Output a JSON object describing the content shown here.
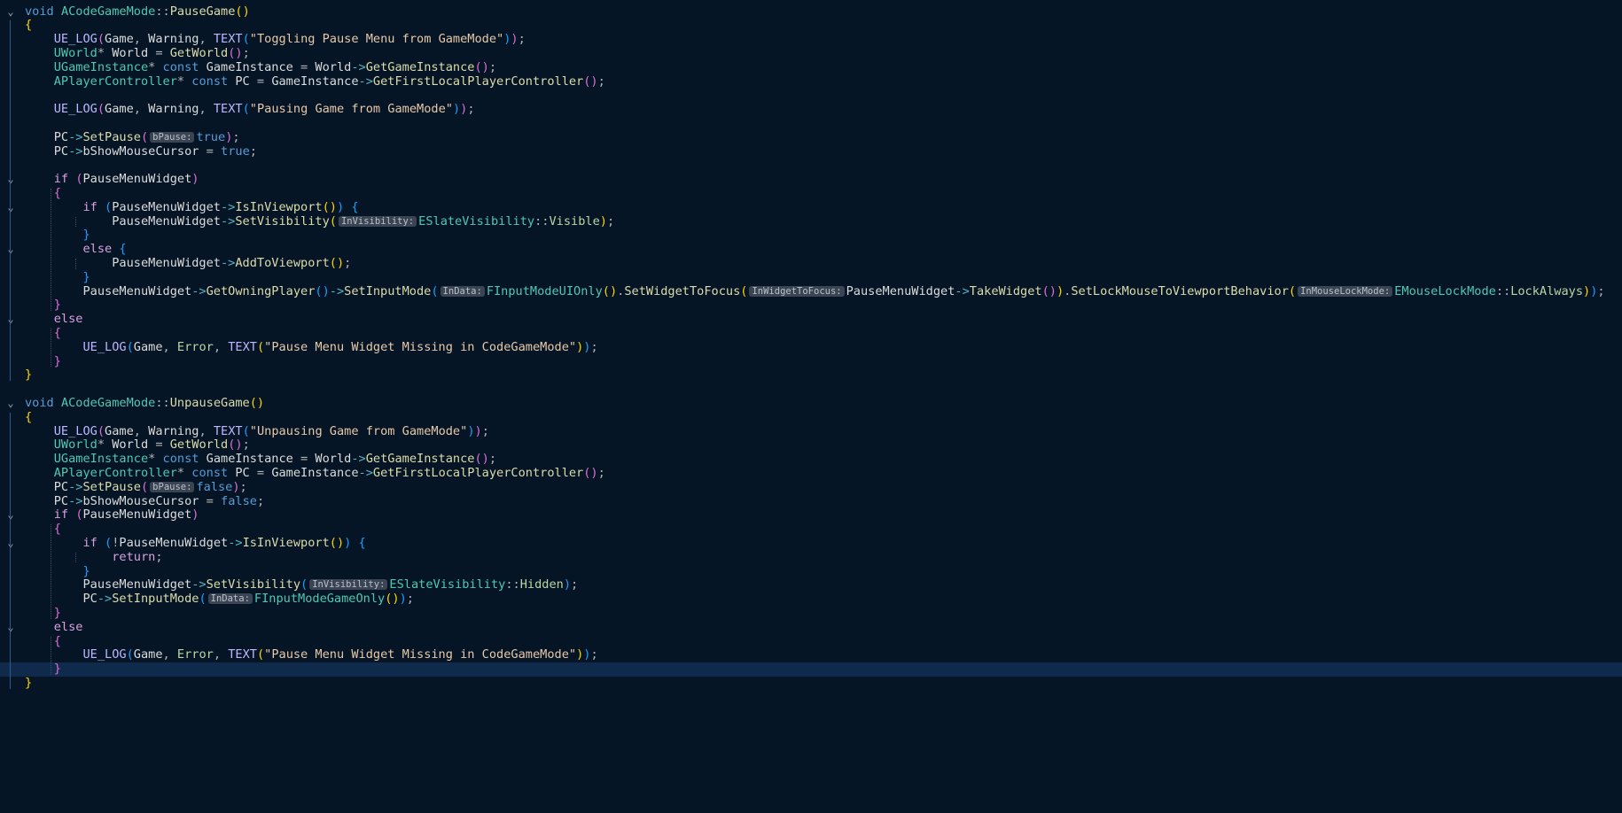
{
  "colors": {
    "background": "#051526",
    "current_line": "#0f2a4a",
    "keyword": "#569cd6",
    "control": "#d8a0df",
    "function": "#dcdcaa",
    "macro": "#beb7ff",
    "string": "#e8c9a7",
    "type": "#4ec9b0",
    "enum": "#b8d7a3"
  },
  "fold_icon": "chevron-down-icon",
  "current_line_index": 47,
  "lines": [
    {
      "fold": true,
      "tokens": [
        [
          "kw",
          "void"
        ],
        [
          "id",
          " "
        ],
        [
          "type",
          "ACodeGameMode"
        ],
        [
          "op",
          "::"
        ],
        [
          "fn",
          "PauseGame"
        ],
        [
          "p1",
          "()"
        ]
      ]
    },
    {
      "tokens": [
        [
          "p1",
          "{"
        ]
      ]
    },
    {
      "tokens": [
        [
          "id",
          "    "
        ],
        [
          "mac",
          "UE_LOG"
        ],
        [
          "p2",
          "("
        ],
        [
          "id",
          "Game"
        ],
        [
          "op",
          ", "
        ],
        [
          "id",
          "Warning"
        ],
        [
          "op",
          ", "
        ],
        [
          "mac",
          "TEXT"
        ],
        [
          "p3",
          "("
        ],
        [
          "str",
          "\"Toggling Pause Menu from GameMode\""
        ],
        [
          "p3",
          ")"
        ],
        [
          "p2",
          ")"
        ],
        [
          "op",
          ";"
        ]
      ]
    },
    {
      "tokens": [
        [
          "id",
          "    "
        ],
        [
          "type",
          "UWorld"
        ],
        [
          "op",
          "* "
        ],
        [
          "var",
          "World"
        ],
        [
          "op",
          " = "
        ],
        [
          "fn",
          "GetWorld"
        ],
        [
          "p2",
          "()"
        ],
        [
          "op",
          ";"
        ]
      ]
    },
    {
      "tokens": [
        [
          "id",
          "    "
        ],
        [
          "type",
          "UGameInstance"
        ],
        [
          "op",
          "* "
        ],
        [
          "kw",
          "const"
        ],
        [
          "id",
          " "
        ],
        [
          "var",
          "GameInstance"
        ],
        [
          "op",
          " = "
        ],
        [
          "var",
          "World"
        ],
        [
          "arrow",
          "->"
        ],
        [
          "fn",
          "GetGameInstance"
        ],
        [
          "p2",
          "()"
        ],
        [
          "op",
          ";"
        ]
      ]
    },
    {
      "tokens": [
        [
          "id",
          "    "
        ],
        [
          "type",
          "APlayerController"
        ],
        [
          "op",
          "* "
        ],
        [
          "kw",
          "const"
        ],
        [
          "id",
          " "
        ],
        [
          "var",
          "PC"
        ],
        [
          "op",
          " = "
        ],
        [
          "var",
          "GameInstance"
        ],
        [
          "arrow",
          "->"
        ],
        [
          "fn",
          "GetFirstLocalPlayerController"
        ],
        [
          "p2",
          "()"
        ],
        [
          "op",
          ";"
        ]
      ]
    },
    {
      "tokens": []
    },
    {
      "tokens": [
        [
          "id",
          "    "
        ],
        [
          "mac",
          "UE_LOG"
        ],
        [
          "p2",
          "("
        ],
        [
          "id",
          "Game"
        ],
        [
          "op",
          ", "
        ],
        [
          "id",
          "Warning"
        ],
        [
          "op",
          ", "
        ],
        [
          "mac",
          "TEXT"
        ],
        [
          "p3",
          "("
        ],
        [
          "str",
          "\"Pausing Game from GameMode\""
        ],
        [
          "p3",
          ")"
        ],
        [
          "p2",
          ")"
        ],
        [
          "op",
          ";"
        ]
      ]
    },
    {
      "tokens": []
    },
    {
      "tokens": [
        [
          "id",
          "    "
        ],
        [
          "var",
          "PC"
        ],
        [
          "arrow",
          "->"
        ],
        [
          "fn",
          "SetPause"
        ],
        [
          "p2",
          "("
        ],
        [
          "hint",
          "bPause:"
        ],
        [
          "kw",
          "true"
        ],
        [
          "p2",
          ")"
        ],
        [
          "op",
          ";"
        ]
      ]
    },
    {
      "tokens": [
        [
          "id",
          "    "
        ],
        [
          "var",
          "PC"
        ],
        [
          "arrow",
          "->"
        ],
        [
          "var",
          "bShowMouseCursor"
        ],
        [
          "op",
          " = "
        ],
        [
          "kw",
          "true"
        ],
        [
          "op",
          ";"
        ]
      ]
    },
    {
      "tokens": []
    },
    {
      "fold": true,
      "tokens": [
        [
          "id",
          "    "
        ],
        [
          "ctl",
          "if"
        ],
        [
          "id",
          " "
        ],
        [
          "p2",
          "("
        ],
        [
          "var",
          "PauseMenuWidget"
        ],
        [
          "p2",
          ")"
        ]
      ]
    },
    {
      "tokens": [
        [
          "id",
          "    "
        ],
        [
          "p2",
          "{"
        ]
      ]
    },
    {
      "fold": true,
      "tokens": [
        [
          "id",
          "        "
        ],
        [
          "ctl",
          "if"
        ],
        [
          "id",
          " "
        ],
        [
          "p3",
          "("
        ],
        [
          "var",
          "PauseMenuWidget"
        ],
        [
          "arrow",
          "->"
        ],
        [
          "fn",
          "IsInViewport"
        ],
        [
          "p1",
          "()"
        ],
        [
          "p3",
          ")"
        ],
        [
          "id",
          " "
        ],
        [
          "p3",
          "{"
        ]
      ]
    },
    {
      "tokens": [
        [
          "id",
          "            "
        ],
        [
          "var",
          "PauseMenuWidget"
        ],
        [
          "arrow",
          "->"
        ],
        [
          "fn",
          "SetVisibility"
        ],
        [
          "p1",
          "("
        ],
        [
          "hint",
          "InVisibility:"
        ],
        [
          "type",
          "ESlateVisibility"
        ],
        [
          "op",
          "::"
        ],
        [
          "enum",
          "Visible"
        ],
        [
          "p1",
          ")"
        ],
        [
          "op",
          ";"
        ]
      ]
    },
    {
      "tokens": [
        [
          "id",
          "        "
        ],
        [
          "p3",
          "}"
        ]
      ]
    },
    {
      "fold": true,
      "tokens": [
        [
          "id",
          "        "
        ],
        [
          "ctl",
          "else"
        ],
        [
          "id",
          " "
        ],
        [
          "p3",
          "{"
        ]
      ]
    },
    {
      "tokens": [
        [
          "id",
          "            "
        ],
        [
          "var",
          "PauseMenuWidget"
        ],
        [
          "arrow",
          "->"
        ],
        [
          "fn",
          "AddToViewport"
        ],
        [
          "p1",
          "()"
        ],
        [
          "op",
          ";"
        ]
      ]
    },
    {
      "tokens": [
        [
          "id",
          "        "
        ],
        [
          "p3",
          "}"
        ]
      ]
    },
    {
      "tokens": [
        [
          "id",
          "        "
        ],
        [
          "var",
          "PauseMenuWidget"
        ],
        [
          "arrow",
          "->"
        ],
        [
          "fn",
          "GetOwningPlayer"
        ],
        [
          "p3",
          "()"
        ],
        [
          "arrow",
          "->"
        ],
        [
          "fn",
          "SetInputMode"
        ],
        [
          "p3",
          "("
        ],
        [
          "hint",
          "InData:"
        ],
        [
          "type",
          "FInputModeUIOnly"
        ],
        [
          "p1",
          "()"
        ],
        [
          "op",
          "."
        ],
        [
          "fn",
          "SetWidgetToFocus"
        ],
        [
          "p1",
          "("
        ],
        [
          "hint",
          "InWidgetToFocus:"
        ],
        [
          "var",
          "PauseMenuWidget"
        ],
        [
          "arrow",
          "->"
        ],
        [
          "fn",
          "TakeWidget"
        ],
        [
          "p2",
          "()"
        ],
        [
          "p1",
          ")"
        ],
        [
          "op",
          "."
        ],
        [
          "fn",
          "SetLockMouseToViewportBehavior"
        ],
        [
          "p1",
          "("
        ],
        [
          "hint",
          "InMouseLockMode:"
        ],
        [
          "type",
          "EMouseLockMode"
        ],
        [
          "op",
          "::"
        ],
        [
          "enum",
          "LockAlways"
        ],
        [
          "p1",
          ")"
        ],
        [
          "p3",
          ")"
        ],
        [
          "op",
          ";"
        ]
      ]
    },
    {
      "tokens": [
        [
          "id",
          "    "
        ],
        [
          "p2",
          "}"
        ]
      ]
    },
    {
      "fold": true,
      "tokens": [
        [
          "id",
          "    "
        ],
        [
          "ctl",
          "else"
        ]
      ]
    },
    {
      "tokens": [
        [
          "id",
          "    "
        ],
        [
          "p2",
          "{"
        ]
      ]
    },
    {
      "tokens": [
        [
          "id",
          "        "
        ],
        [
          "mac",
          "UE_LOG"
        ],
        [
          "p3",
          "("
        ],
        [
          "id",
          "Game"
        ],
        [
          "op",
          ", "
        ],
        [
          "enum",
          "Error"
        ],
        [
          "op",
          ", "
        ],
        [
          "mac",
          "TEXT"
        ],
        [
          "p1",
          "("
        ],
        [
          "str",
          "\"Pause Menu Widget Missing in CodeGameMode\""
        ],
        [
          "p1",
          ")"
        ],
        [
          "p3",
          ")"
        ],
        [
          "op",
          ";"
        ]
      ]
    },
    {
      "tokens": [
        [
          "id",
          "    "
        ],
        [
          "p2",
          "}"
        ]
      ]
    },
    {
      "tokens": [
        [
          "p1",
          "}"
        ]
      ]
    },
    {
      "tokens": []
    },
    {
      "fold": true,
      "tokens": [
        [
          "kw",
          "void"
        ],
        [
          "id",
          " "
        ],
        [
          "type",
          "ACodeGameMode"
        ],
        [
          "op",
          "::"
        ],
        [
          "fn",
          "UnpauseGame"
        ],
        [
          "p1",
          "()"
        ]
      ]
    },
    {
      "tokens": [
        [
          "p1",
          "{"
        ]
      ]
    },
    {
      "tokens": [
        [
          "id",
          "    "
        ],
        [
          "mac",
          "UE_LOG"
        ],
        [
          "p2",
          "("
        ],
        [
          "id",
          "Game"
        ],
        [
          "op",
          ", "
        ],
        [
          "id",
          "Warning"
        ],
        [
          "op",
          ", "
        ],
        [
          "mac",
          "TEXT"
        ],
        [
          "p3",
          "("
        ],
        [
          "str",
          "\"Unpausing Game from GameMode\""
        ],
        [
          "p3",
          ")"
        ],
        [
          "p2",
          ")"
        ],
        [
          "op",
          ";"
        ]
      ]
    },
    {
      "tokens": [
        [
          "id",
          "    "
        ],
        [
          "type",
          "UWorld"
        ],
        [
          "op",
          "* "
        ],
        [
          "var",
          "World"
        ],
        [
          "op",
          " = "
        ],
        [
          "fn",
          "GetWorld"
        ],
        [
          "p2",
          "()"
        ],
        [
          "op",
          ";"
        ]
      ]
    },
    {
      "tokens": [
        [
          "id",
          "    "
        ],
        [
          "type",
          "UGameInstance"
        ],
        [
          "op",
          "* "
        ],
        [
          "kw",
          "const"
        ],
        [
          "id",
          " "
        ],
        [
          "var",
          "GameInstance"
        ],
        [
          "op",
          " = "
        ],
        [
          "var",
          "World"
        ],
        [
          "arrow",
          "->"
        ],
        [
          "fn",
          "GetGameInstance"
        ],
        [
          "p2",
          "()"
        ],
        [
          "op",
          ";"
        ]
      ]
    },
    {
      "tokens": [
        [
          "id",
          "    "
        ],
        [
          "type",
          "APlayerController"
        ],
        [
          "op",
          "* "
        ],
        [
          "kw",
          "const"
        ],
        [
          "id",
          " "
        ],
        [
          "var",
          "PC"
        ],
        [
          "op",
          " = "
        ],
        [
          "var",
          "GameInstance"
        ],
        [
          "arrow",
          "->"
        ],
        [
          "fn",
          "GetFirstLocalPlayerController"
        ],
        [
          "p2",
          "()"
        ],
        [
          "op",
          ";"
        ]
      ]
    },
    {
      "tokens": [
        [
          "id",
          "    "
        ],
        [
          "var",
          "PC"
        ],
        [
          "arrow",
          "->"
        ],
        [
          "fn",
          "SetPause"
        ],
        [
          "p2",
          "("
        ],
        [
          "hint",
          "bPause:"
        ],
        [
          "kw",
          "false"
        ],
        [
          "p2",
          ")"
        ],
        [
          "op",
          ";"
        ]
      ]
    },
    {
      "tokens": [
        [
          "id",
          "    "
        ],
        [
          "var",
          "PC"
        ],
        [
          "arrow",
          "->"
        ],
        [
          "var",
          "bShowMouseCursor"
        ],
        [
          "op",
          " = "
        ],
        [
          "kw",
          "false"
        ],
        [
          "op",
          ";"
        ]
      ]
    },
    {
      "fold": true,
      "tokens": [
        [
          "id",
          "    "
        ],
        [
          "ctl",
          "if"
        ],
        [
          "id",
          " "
        ],
        [
          "p2",
          "("
        ],
        [
          "var",
          "PauseMenuWidget"
        ],
        [
          "p2",
          ")"
        ]
      ]
    },
    {
      "tokens": [
        [
          "id",
          "    "
        ],
        [
          "p2",
          "{"
        ]
      ]
    },
    {
      "fold": true,
      "tokens": [
        [
          "id",
          "        "
        ],
        [
          "ctl",
          "if"
        ],
        [
          "id",
          " "
        ],
        [
          "p3",
          "("
        ],
        [
          "op",
          "!"
        ],
        [
          "var",
          "PauseMenuWidget"
        ],
        [
          "arrow",
          "->"
        ],
        [
          "fn",
          "IsInViewport"
        ],
        [
          "p1",
          "()"
        ],
        [
          "p3",
          ")"
        ],
        [
          "id",
          " "
        ],
        [
          "p3",
          "{"
        ]
      ]
    },
    {
      "tokens": [
        [
          "id",
          "            "
        ],
        [
          "ctl",
          "return"
        ],
        [
          "op",
          ";"
        ]
      ]
    },
    {
      "tokens": [
        [
          "id",
          "        "
        ],
        [
          "p3",
          "}"
        ]
      ]
    },
    {
      "tokens": [
        [
          "id",
          "        "
        ],
        [
          "var",
          "PauseMenuWidget"
        ],
        [
          "arrow",
          "->"
        ],
        [
          "fn",
          "SetVisibility"
        ],
        [
          "p3",
          "("
        ],
        [
          "hint",
          "InVisibility:"
        ],
        [
          "type",
          "ESlateVisibility"
        ],
        [
          "op",
          "::"
        ],
        [
          "enum",
          "Hidden"
        ],
        [
          "p3",
          ")"
        ],
        [
          "op",
          ";"
        ]
      ]
    },
    {
      "tokens": [
        [
          "id",
          "        "
        ],
        [
          "var",
          "PC"
        ],
        [
          "arrow",
          "->"
        ],
        [
          "fn",
          "SetInputMode"
        ],
        [
          "p3",
          "("
        ],
        [
          "hint",
          "InData:"
        ],
        [
          "type",
          "FInputModeGameOnly"
        ],
        [
          "p1",
          "()"
        ],
        [
          "p3",
          ")"
        ],
        [
          "op",
          ";"
        ]
      ]
    },
    {
      "tokens": [
        [
          "id",
          "    "
        ],
        [
          "p2",
          "}"
        ]
      ]
    },
    {
      "fold": true,
      "tokens": [
        [
          "id",
          "    "
        ],
        [
          "ctl",
          "else"
        ]
      ]
    },
    {
      "tokens": [
        [
          "id",
          "    "
        ],
        [
          "p2",
          "{"
        ]
      ]
    },
    {
      "tokens": [
        [
          "id",
          "        "
        ],
        [
          "mac",
          "UE_LOG"
        ],
        [
          "p3",
          "("
        ],
        [
          "id",
          "Game"
        ],
        [
          "op",
          ", "
        ],
        [
          "enum",
          "Error"
        ],
        [
          "op",
          ", "
        ],
        [
          "mac",
          "TEXT"
        ],
        [
          "p1",
          "("
        ],
        [
          "str",
          "\"Pause Menu Widget Missing in CodeGameMode\""
        ],
        [
          "p1",
          ")"
        ],
        [
          "p3",
          ")"
        ],
        [
          "op",
          ";"
        ]
      ]
    },
    {
      "tokens": [
        [
          "id",
          "    "
        ],
        [
          "p2",
          "}"
        ]
      ]
    },
    {
      "tokens": [
        [
          "p1",
          "}"
        ]
      ]
    }
  ]
}
